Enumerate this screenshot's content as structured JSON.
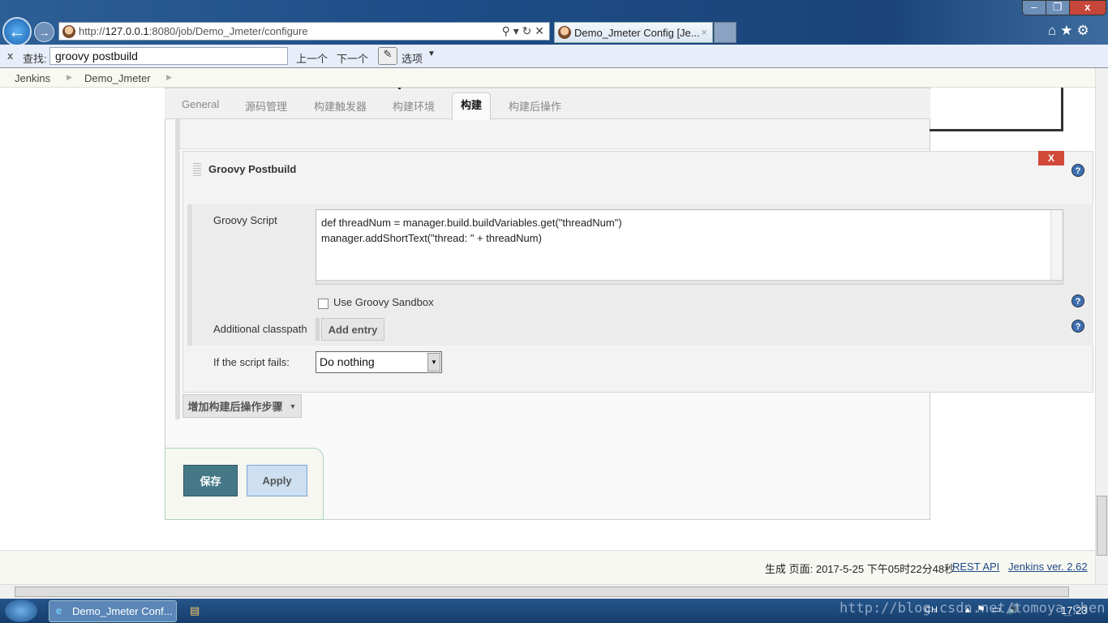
{
  "browser": {
    "url_prefix": "http://",
    "url_host": "127.0.0.1",
    "url_rest": ":8080/job/Demo_Jmeter/configure",
    "tab_title": "Demo_Jmeter Config [Je...",
    "tab_close": "×"
  },
  "findbar": {
    "close": "x",
    "label": "查找:",
    "query": "groovy postbuild",
    "prev": "上一个",
    "next": "下一个",
    "options": "选项"
  },
  "breadcrumb": [
    "Jenkins",
    "Demo_Jmeter"
  ],
  "tabs": [
    "General",
    "源码管理",
    "构建触发器",
    "构建环境",
    "构建",
    "构建后操作"
  ],
  "active_tab": "构建",
  "section": {
    "title": "Groovy Postbuild",
    "delete": "X",
    "script_label": "Groovy Script",
    "script": "def threadNum = manager.build.buildVariables.get(\"threadNum\")\nmanager.addShortText(\"thread: \" + threadNum)",
    "sandbox_label": "Use Groovy Sandbox",
    "sandbox_checked": false,
    "classpath_label": "Additional classpath",
    "add_entry": "Add entry",
    "fails_label": "If the script fails:",
    "fails_value": "Do nothing"
  },
  "add_step": "增加构建后操作步骤",
  "save": "保存",
  "apply": "Apply",
  "footer": {
    "generated": "生成 页面: 2017-5-25 下午05时22分48秒",
    "rest_api": "REST API",
    "version": "Jenkins ver. 2.62"
  },
  "taskbar": {
    "window": "Demo_Jmeter Conf...",
    "lang": "CH",
    "clock": "17:23",
    "watermark": "http://blog.csdn.net/tomoya_chen"
  },
  "colors": {
    "save": "#457887",
    "apply": "#cddff0",
    "delete": "#d24939"
  }
}
